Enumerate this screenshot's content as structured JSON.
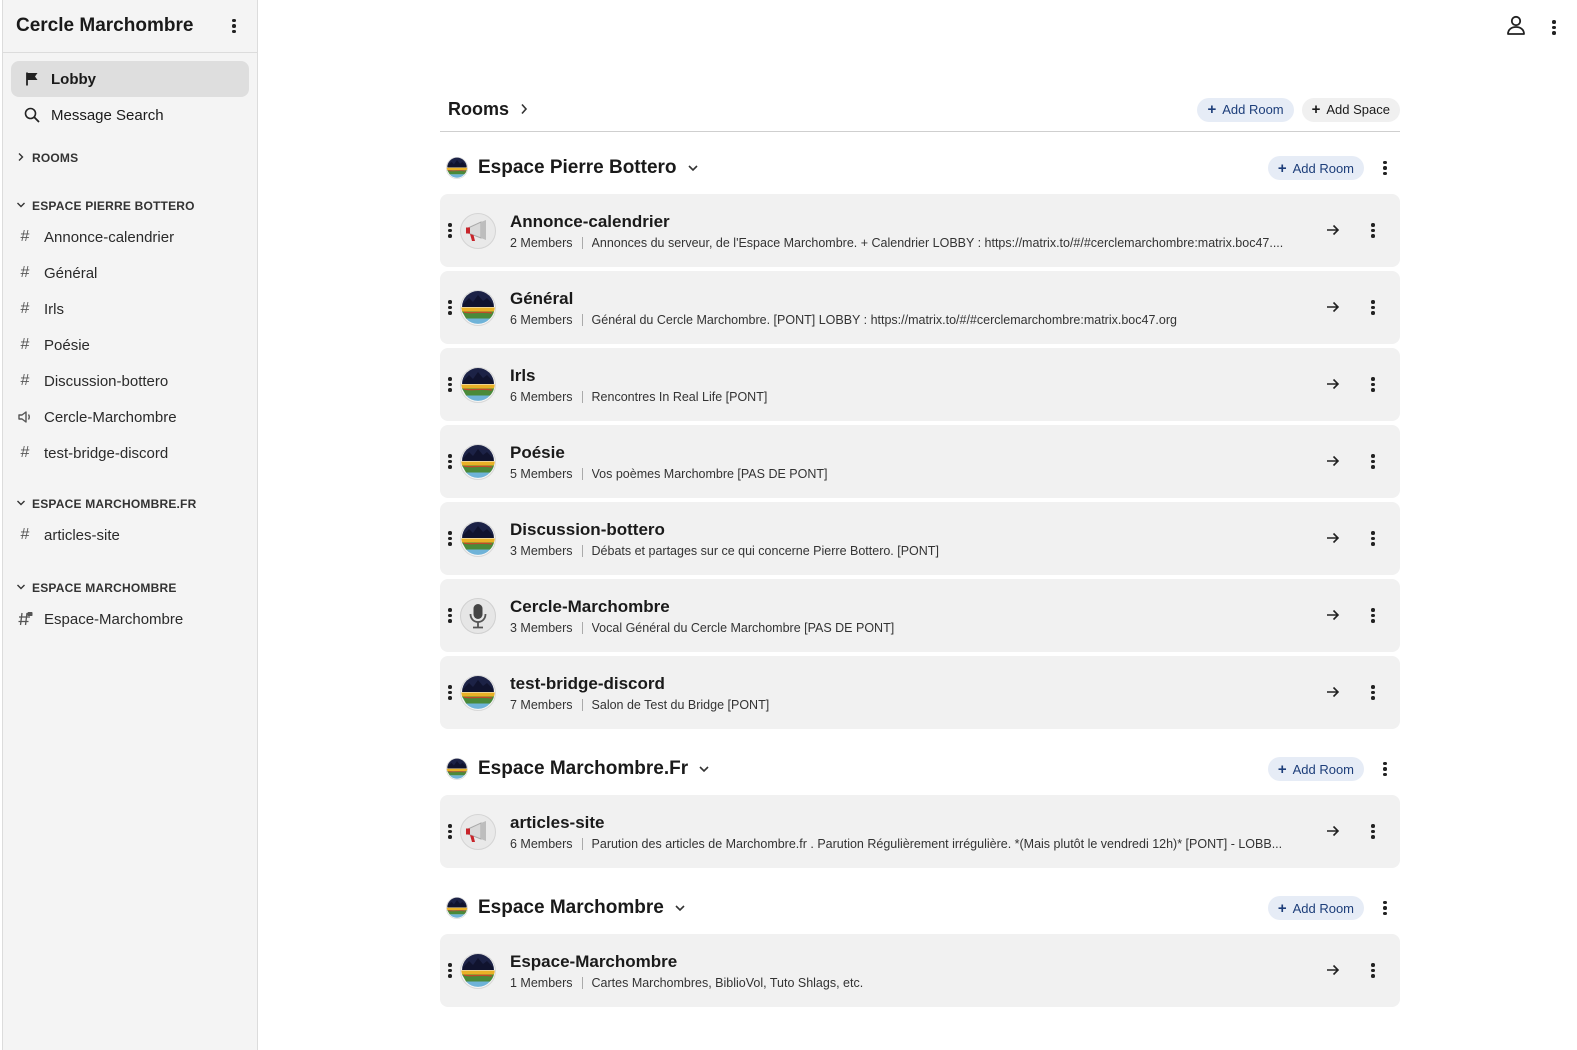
{
  "sidebar": {
    "title": "Cercle Marchombre",
    "nav": [
      {
        "label": "Lobby",
        "icon": "flag-icon"
      },
      {
        "label": "Message Search",
        "icon": "search-icon"
      }
    ],
    "rooms_section": "ROOMS",
    "spaces": [
      {
        "name": "ESPACE PIERRE BOTTERO",
        "rooms": [
          {
            "label": "Annonce-calendrier",
            "icon": "hash-icon"
          },
          {
            "label": "Général",
            "icon": "hash-icon"
          },
          {
            "label": "Irls",
            "icon": "hash-icon"
          },
          {
            "label": "Poésie",
            "icon": "hash-icon"
          },
          {
            "label": "Discussion-bottero",
            "icon": "hash-icon"
          },
          {
            "label": "Cercle-Marchombre",
            "icon": "speaker-icon"
          },
          {
            "label": "test-bridge-discord",
            "icon": "hash-icon"
          }
        ]
      },
      {
        "name": "ESPACE MARCHOMBRE.FR",
        "rooms": [
          {
            "label": "articles-site",
            "icon": "hash-icon"
          }
        ]
      },
      {
        "name": "ESPACE MARCHOMBRE",
        "rooms": [
          {
            "label": "Espace-Marchombre",
            "icon": "hash-lock-icon"
          }
        ]
      }
    ]
  },
  "main": {
    "rooms_title": "Rooms",
    "add_room": "Add Room",
    "add_space": "Add Space",
    "spaces": [
      {
        "name": "Espace Pierre Bottero",
        "add_room": "Add Room",
        "rooms": [
          {
            "name": "Annonce-calendrier",
            "members": "2 Members",
            "topic": "Annonces du serveur, de l'Espace Marchombre. + Calendrier LOBBY : https://matrix.to/#/#cerclemarchombre:matrix.boc47....",
            "avatar": "megaphone"
          },
          {
            "name": "Général",
            "members": "6 Members",
            "topic": "Général du Cercle Marchombre. [PONT] LOBBY : https://matrix.to/#/#cerclemarchombre:matrix.boc47.org",
            "avatar": "landscape"
          },
          {
            "name": "Irls",
            "members": "6 Members",
            "topic": "Rencontres In Real Life [PONT]",
            "avatar": "landscape"
          },
          {
            "name": "Poésie",
            "members": "5 Members",
            "topic": "Vos poèmes Marchombre [PAS DE PONT]",
            "avatar": "landscape"
          },
          {
            "name": "Discussion-bottero",
            "members": "3 Members",
            "topic": "Débats et partages sur ce qui concerne Pierre Bottero. [PONT]",
            "avatar": "landscape"
          },
          {
            "name": "Cercle-Marchombre",
            "members": "3 Members",
            "topic": "Vocal Général du Cercle Marchombre [PAS DE PONT]",
            "avatar": "microphone"
          },
          {
            "name": "test-bridge-discord",
            "members": "7 Members",
            "topic": "Salon de Test du Bridge [PONT]",
            "avatar": "landscape"
          }
        ]
      },
      {
        "name": "Espace Marchombre.Fr",
        "add_room": "Add Room",
        "rooms": [
          {
            "name": "articles-site",
            "members": "6 Members",
            "topic": "Parution des articles de Marchombre.fr . Parution Régulièrement irrégulière. *(Mais plutôt le vendredi 12h)* [PONT] - LOBB...",
            "avatar": "megaphone"
          }
        ]
      },
      {
        "name": "Espace Marchombre",
        "add_room": "Add Room",
        "rooms": [
          {
            "name": "Espace-Marchombre",
            "members": "1 Members",
            "topic": "Cartes Marchombres, BiblioVol, Tuto Shlags, etc.",
            "avatar": "landscape"
          }
        ]
      }
    ]
  },
  "topbar": {
    "icons": [
      "user-icon",
      "more-options-icon"
    ]
  },
  "colors": {
    "accent_pill_bg": "#e6ecf6",
    "accent_pill_text": "#1d3e7a",
    "card_bg": "#f1f1f1",
    "sidebar_bg": "#f4f4f4"
  }
}
